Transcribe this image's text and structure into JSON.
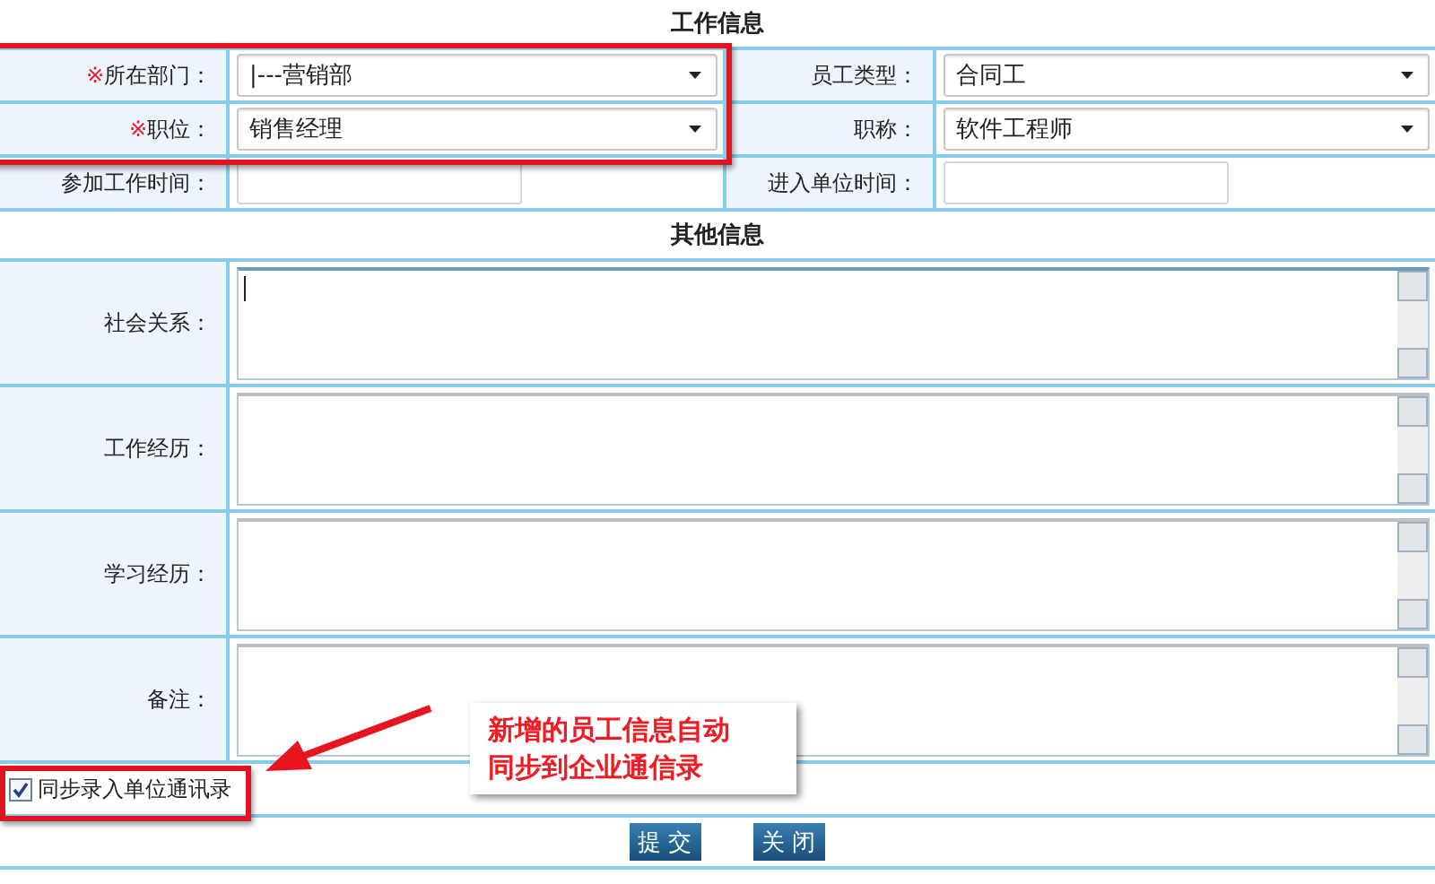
{
  "work_section": {
    "title": "工作信息",
    "fields": [
      {
        "mark": "※",
        "label": "所在部门：",
        "kind": "select",
        "value": "|---营销部"
      },
      {
        "label": "员工类型：",
        "kind": "select",
        "value": "合同工"
      },
      {
        "mark": "※",
        "label": "职位：",
        "kind": "select",
        "value": "销售经理"
      },
      {
        "label": "职称：",
        "kind": "select",
        "value": "软件工程师"
      },
      {
        "label": "参加工作时间：",
        "kind": "date"
      },
      {
        "label": "进入单位时间：",
        "kind": "date"
      }
    ]
  },
  "other_section": {
    "title": "其他信息",
    "fields": [
      {
        "label": "社会关系：",
        "focused": true
      },
      {
        "label": "工作经历：",
        "focused": false
      },
      {
        "label": "学习经历：",
        "focused": false
      },
      {
        "label": "备注：",
        "focused": false
      }
    ]
  },
  "sync_checkbox": {
    "label": "同步录入单位通讯录",
    "checked": true
  },
  "buttons": [
    "提 交",
    "关 闭"
  ],
  "callout": {
    "lines": [
      "新增的员工信息自动",
      "同步到企业通信录"
    ]
  }
}
